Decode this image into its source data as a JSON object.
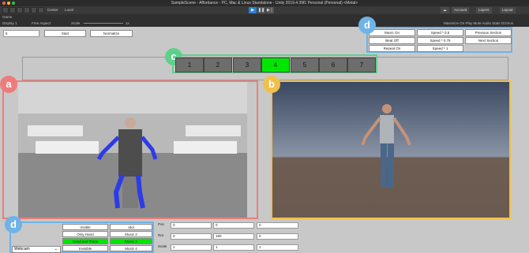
{
  "window": {
    "title": "SampleScene - Affordance - PC, Mac & Linux Standalone - Unity 2019.4.39f1 Personal (Personal) <Metal>"
  },
  "toolbar": {
    "center_label": "Center",
    "local_label": "Local",
    "play_icon": "play-icon",
    "account_label": "Account",
    "layers_label": "Layers",
    "layout_label": "Layout"
  },
  "gamebar": {
    "tab_label": "Game",
    "display_label": "Display 1",
    "aspect_label": "Free Aspect",
    "scale_label": "Scale",
    "scale_value": "1x",
    "right_opts": "Maximize On Play   Mute Audio   Stats   Gizmos"
  },
  "top_controls": {
    "frame_field": "5",
    "start_label": "Start",
    "normalize_label": "Normalize"
  },
  "right_controls": {
    "col1": [
      "Music On",
      "Beat Off",
      "Repeat On"
    ],
    "col2": [
      "Speed * 0.5",
      "Speed * 0.75",
      "Speed * 1"
    ],
    "col3": [
      "Previous Section",
      "Next Section"
    ]
  },
  "numbers": {
    "items": [
      "1",
      "2",
      "3",
      "4",
      "5",
      "6",
      "7"
    ],
    "active_index": 3
  },
  "badges": {
    "a": "a",
    "b": "b",
    "c": "c",
    "d_top": "d",
    "d_bottom": "d"
  },
  "bottom_controls": {
    "source_select": "Webcam",
    "col1": [
      "Visible",
      "Only Hand",
      "Hand and Trace",
      "Invisible"
    ],
    "col2": [
      "Idol",
      "Music 2",
      "Music 3",
      "Music 4"
    ],
    "col1_active_index": 2,
    "col2_active_index": 2
  },
  "transform": {
    "pos_label": "Pos",
    "rot_label": "Rot",
    "scale_label": "Scale",
    "pos": [
      "0",
      "0",
      "0"
    ],
    "rot": [
      "0",
      "180",
      "0"
    ],
    "scale": [
      "1",
      "1",
      "1"
    ]
  },
  "colors": {
    "badge_a": "#ee7c7c",
    "badge_b": "#f0c04a",
    "badge_c": "#5fd08a",
    "badge_d": "#6fb3e8",
    "active_green": "#00e600"
  }
}
